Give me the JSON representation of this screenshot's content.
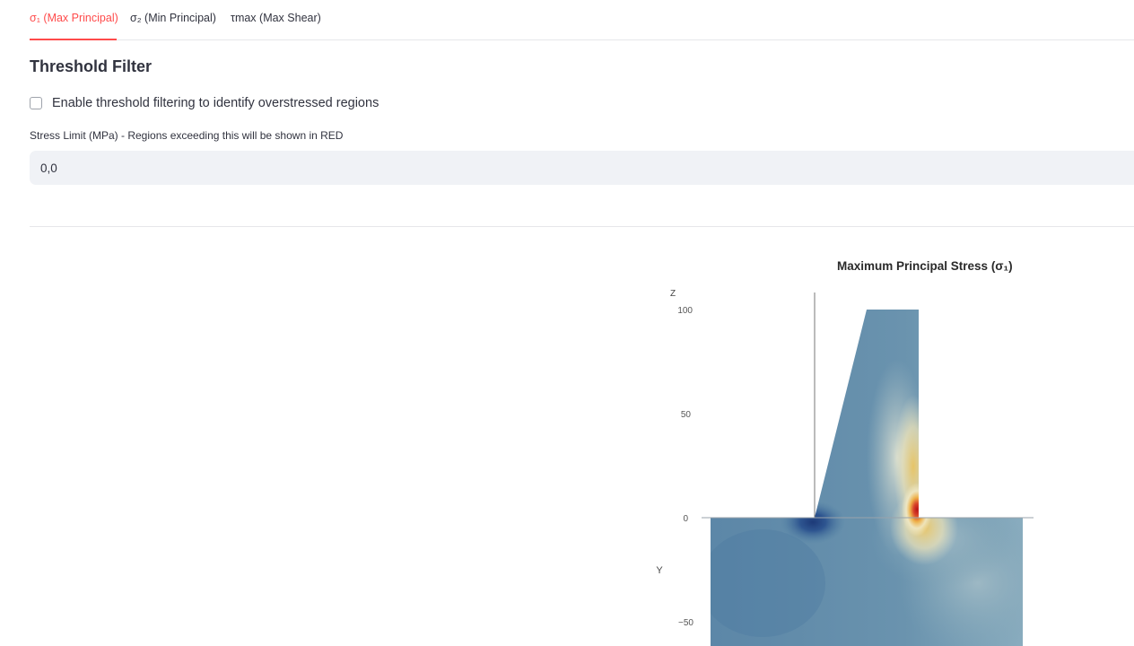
{
  "tabs": [
    {
      "label": "σ₁ (Max Principal)",
      "active": true
    },
    {
      "label": "σ₂ (Min Principal)",
      "active": false
    },
    {
      "label": "τmax (Max Shear)",
      "active": false
    }
  ],
  "threshold": {
    "heading": "Threshold Filter",
    "checkbox_label": "Enable threshold filtering to identify overstressed regions",
    "checkbox_checked": false,
    "limit_label": "Stress Limit (MPa) - Regions exceeding this will be shown in RED",
    "limit_value": "0,0"
  },
  "chart": {
    "title": "Maximum Principal Stress (σ₁)",
    "z_axis_label": "Z",
    "y_axis_label": "Y",
    "ticks": [
      "100",
      "50",
      "0",
      "−50"
    ],
    "colors": {
      "base": "#5d8aa8",
      "low": "#2b4e86",
      "mid": "#f1e9c5",
      "high": "#b8141a"
    }
  },
  "chart_data": {
    "type": "heatmap",
    "title": "Maximum Principal Stress (σ₁)",
    "xlabel": "Y",
    "ylabel": "Z",
    "yticks": [
      100,
      50,
      0,
      -50
    ],
    "ylim": [
      -60,
      108
    ]
  }
}
